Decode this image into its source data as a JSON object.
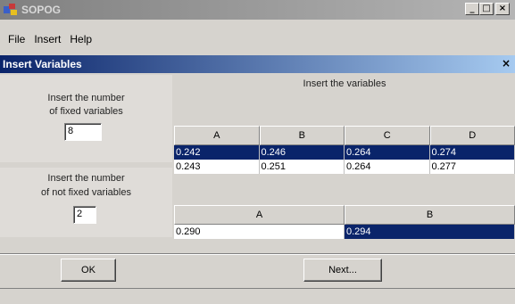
{
  "app": {
    "title": "SOPOG"
  },
  "window_buttons": {
    "minimize": "_",
    "maximize": "□",
    "close": "×"
  },
  "menu": [
    "File",
    "Insert",
    "Help"
  ],
  "dialog": {
    "title": "Insert Variables",
    "close": "×",
    "fixed": {
      "label_line1": "Insert the number",
      "label_line2": "of fixed  variables",
      "value": "8"
    },
    "not_fixed": {
      "label_line1": "Insert the number",
      "label_line2": "of not fixed variables",
      "value": "2"
    },
    "insert_label": "Insert  the variables",
    "table1": {
      "headers": [
        "A",
        "B",
        "C",
        "D"
      ],
      "rows": [
        {
          "selected": true,
          "cells": [
            "0.242",
            "0.246",
            "0.264",
            "0.274"
          ]
        },
        {
          "selected": false,
          "cells": [
            "0.243",
            "0.251",
            "0.264",
            "0.277"
          ]
        }
      ]
    },
    "table2": {
      "headers": [
        "A",
        "B"
      ],
      "cells": [
        "0.290",
        "0.294"
      ],
      "selected_cell": 1
    },
    "ok_label": "OK",
    "next_label": "Next..."
  },
  "colors": {
    "title_active": "#0a246a",
    "selection": "#0a246a",
    "face": "#d6d3ce"
  }
}
